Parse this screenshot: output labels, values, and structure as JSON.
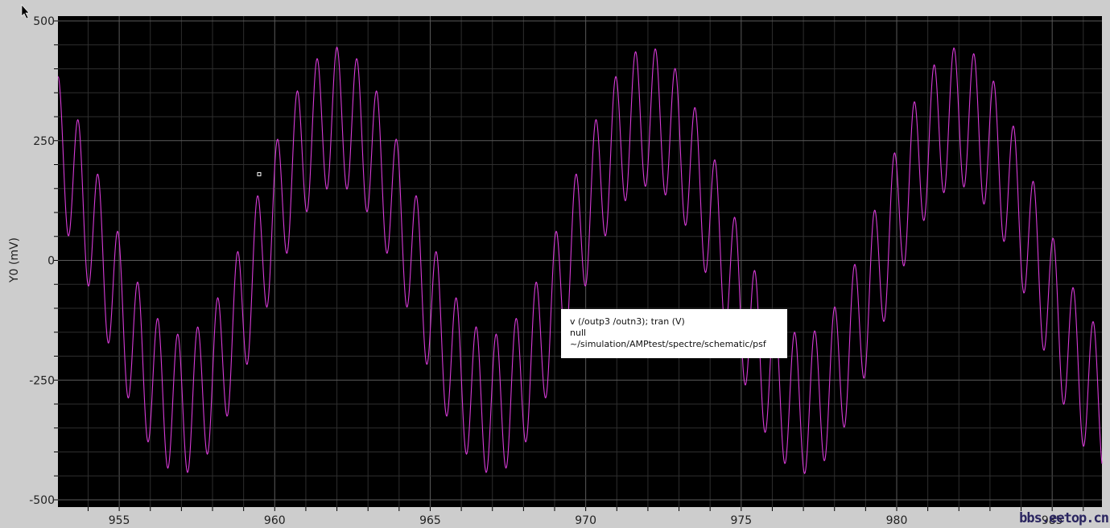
{
  "chart_data": {
    "type": "line",
    "title": "",
    "xlabel": "",
    "ylabel": "Y0 (mV)",
    "xlim": [
      953.03,
      986.6
    ],
    "ylim": [
      -500,
      500
    ],
    "xticks": [
      955,
      960,
      965,
      970,
      975,
      980,
      985
    ],
    "yticks": [
      500,
      250,
      0,
      -250,
      -500
    ],
    "grid": true,
    "series": [
      {
        "name": "v (/outp3 /outn3); tran (V)",
        "color": "#d63ad6",
        "model": "sum of cosines centered at x=962",
        "components": [
          {
            "amplitude_mV": 300,
            "period": 10.0,
            "peak_at": 962
          },
          {
            "amplitude_mV": 145,
            "period": 0.64,
            "peak_at": 962
          }
        ]
      }
    ],
    "marker": {
      "x": 959.5,
      "y": 180
    }
  },
  "tooltip": {
    "line1": "v (/outp3  /outn3); tran (V)",
    "line2": "null",
    "line3": "~/simulation/AMPtest/spectre/schematic/psf"
  },
  "watermark": "bbs.eetop.cn"
}
